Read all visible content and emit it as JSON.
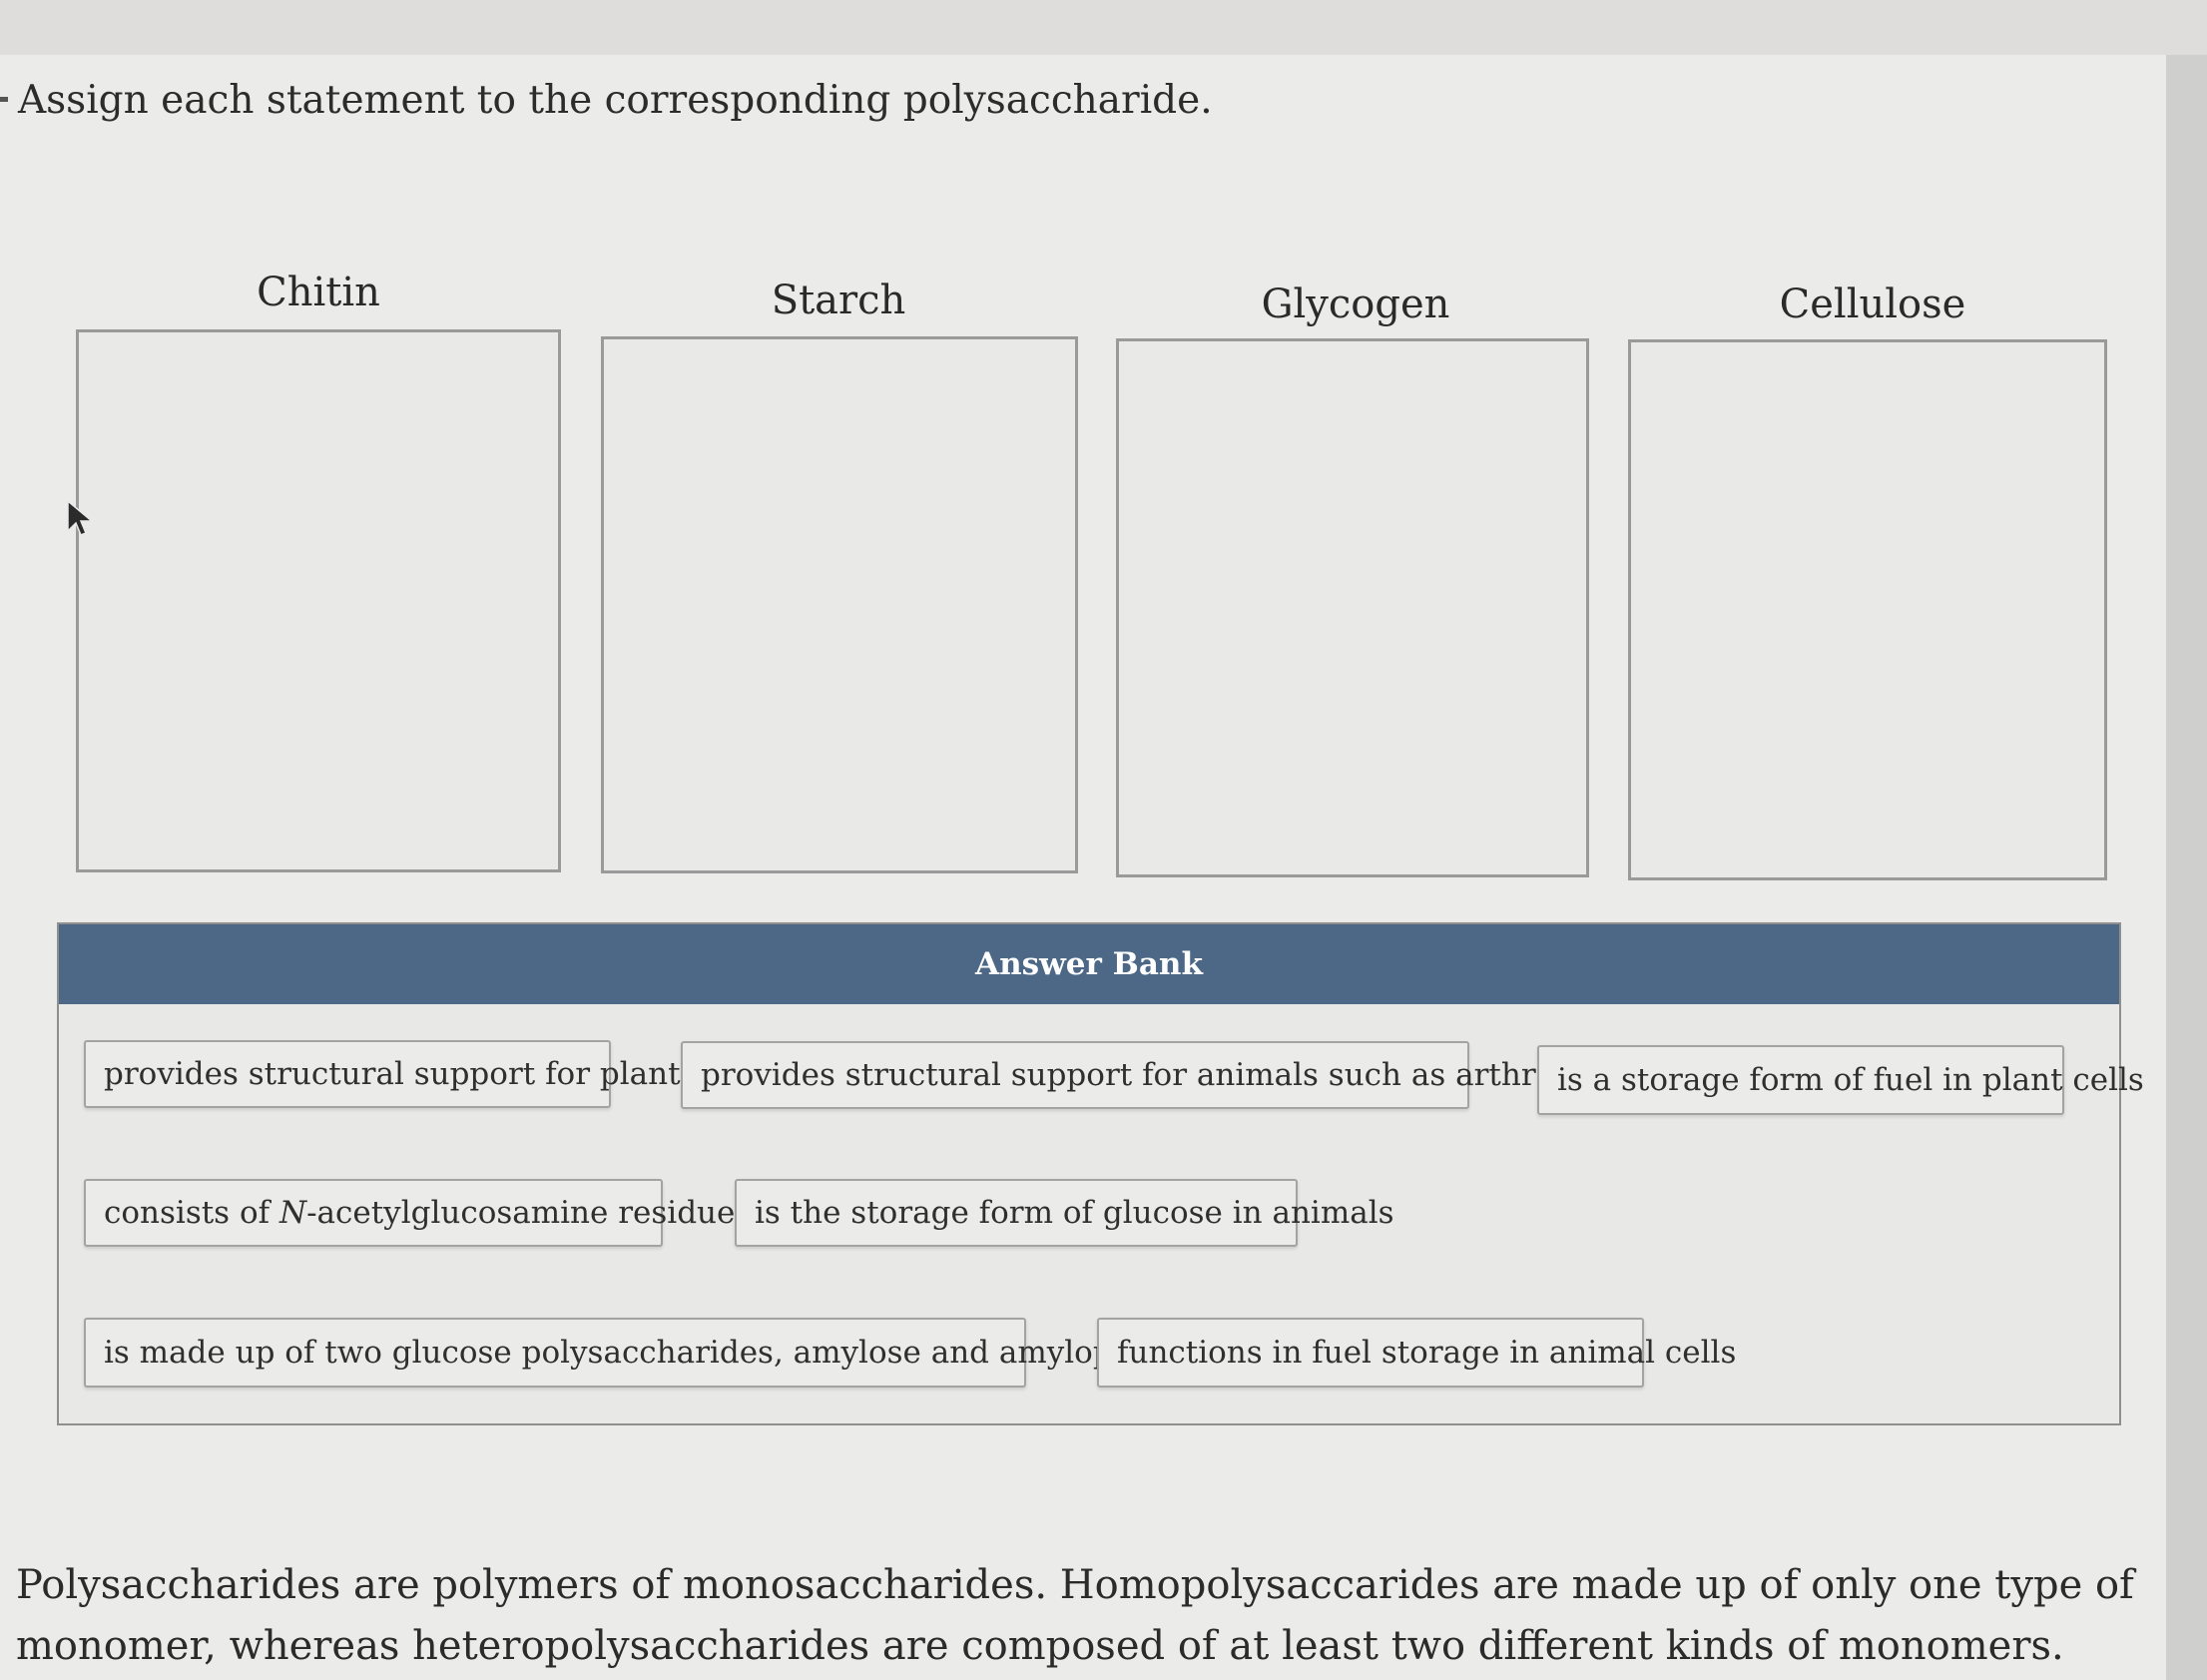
{
  "question": {
    "prompt": "Assign each statement to the corresponding polysaccharide."
  },
  "targets": [
    {
      "label": "Chitin"
    },
    {
      "label": "Starch"
    },
    {
      "label": "Glycogen"
    },
    {
      "label": "Cellulose"
    }
  ],
  "answer_bank": {
    "title": "Answer Bank",
    "items": [
      {
        "text": "provides structural support for plants"
      },
      {
        "text": "provides structural support for animals such as arthropods"
      },
      {
        "text": "is a storage form of fuel in plant cells"
      },
      {
        "pre": "consists of ",
        "em": "N",
        "post": "-acetylglucosamine residues"
      },
      {
        "text": "is the storage form of glucose in animals"
      },
      {
        "text": "is made up of two glucose polysaccharides, amylose and amylopectin"
      },
      {
        "text": "functions in fuel storage in animal cells"
      }
    ]
  },
  "intro": {
    "text": "Polysaccharides are polymers of monosaccharides. Homopolysaccarides are made up of only one type of monomer, whereas heteropolysaccharides are composed of at least two different kinds of monomers."
  },
  "colors": {
    "header_bg": "#4d6887",
    "page_bg": "#ebebea",
    "border": "#9a9a9a"
  }
}
